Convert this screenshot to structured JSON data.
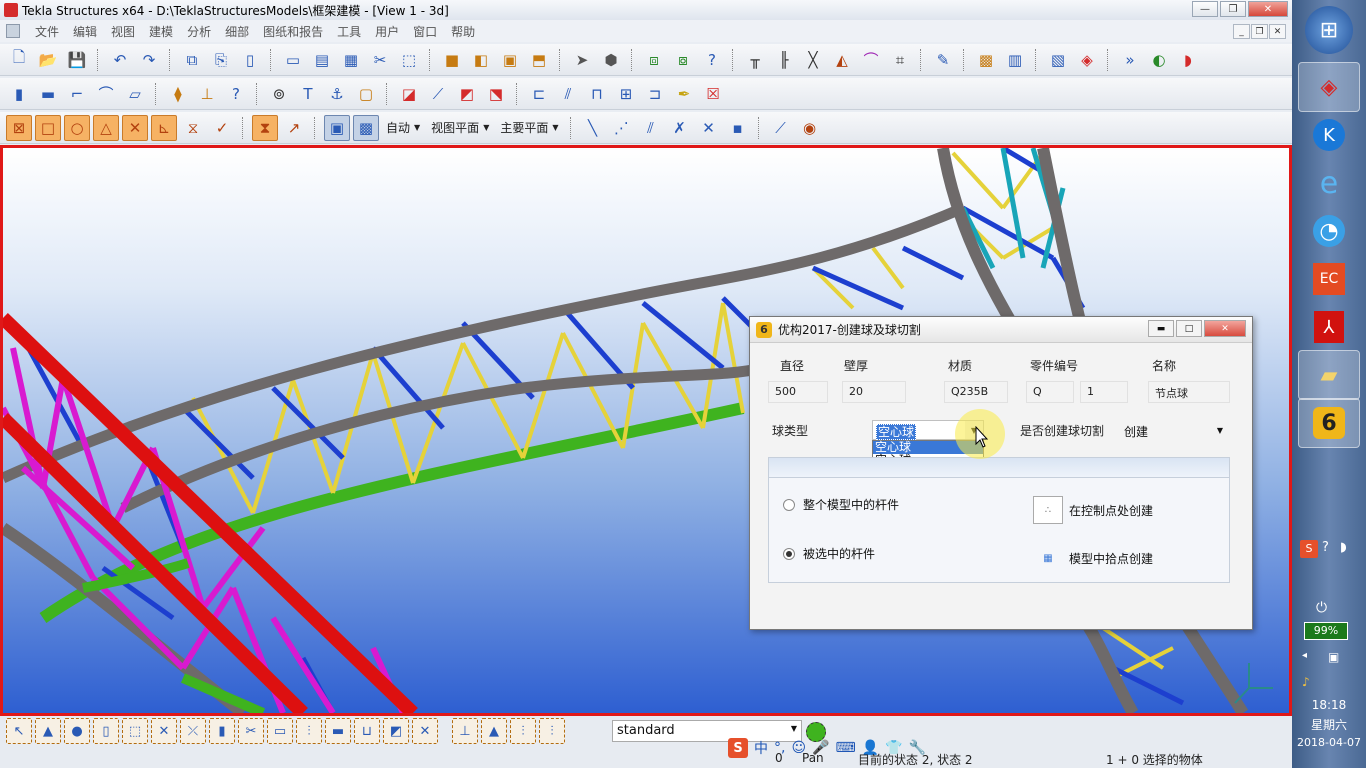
{
  "window": {
    "title": "Tekla Structures x64 - D:\\TeklaStructuresModels\\框架建模 - [View 1 - 3d]"
  },
  "menu": {
    "items": [
      "文件",
      "编辑",
      "视图",
      "建模",
      "分析",
      "细部",
      "图纸和报告",
      "工具",
      "用户",
      "窗口",
      "帮助"
    ]
  },
  "toolbar3": {
    "auto_label": "自动",
    "viewplane_label": "视图平面",
    "mainplane_label": "主要平面"
  },
  "dialog": {
    "title": "优构2017-创建球及球切割",
    "headers": {
      "diameter": "直径",
      "thickness": "壁厚",
      "material": "材质",
      "part_no": "零件编号",
      "name": "名称"
    },
    "values": {
      "diameter": "500",
      "thickness": "20",
      "material": "Q235B",
      "part_prefix": "Q",
      "part_start": "1",
      "name": "节点球"
    },
    "ball_type_label": "球类型",
    "ball_type_value": "空心球",
    "ball_type_options": [
      "空心球",
      "实心球"
    ],
    "cut_label": "是否创建球切割",
    "cut_value": "创建",
    "radio_all": "整个模型中的杆件",
    "radio_selected": "被选中的杆件",
    "radio_selected_checked": true,
    "btn_control_points": "在控制点处创建",
    "btn_pick": "模型中拾点创建"
  },
  "bottom": {
    "filter_value": "standard",
    "status_left": "0",
    "status_pan": "Pan",
    "status_state": "目前的状态 2, 状态 2",
    "status_selected": "1 + 0 选择的物体"
  },
  "ime": {
    "chinese": "中"
  },
  "taskbar": {
    "battery": "99%",
    "time": "18:18",
    "weekday": "星期六",
    "date": "2018-04-07"
  },
  "colors": {
    "viewport_border": "#e01818",
    "truss_gray": "#6e6a6a",
    "truss_yellow": "#e5d23a",
    "truss_blue": "#1d3fcf",
    "truss_magenta": "#d81ad0",
    "truss_green": "#3fb31f",
    "truss_red": "#dd1010",
    "truss_cyan": "#18a5b8"
  }
}
